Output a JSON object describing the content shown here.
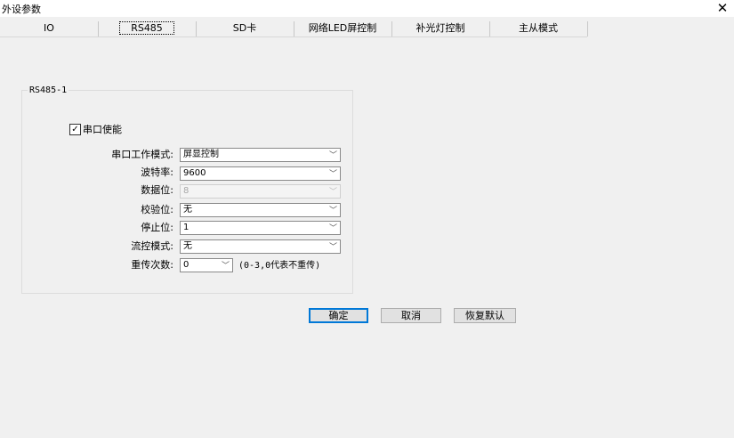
{
  "window": {
    "title": "外设参数",
    "close_glyph": "✕"
  },
  "tabs": [
    {
      "label": "IO"
    },
    {
      "label": "RS485"
    },
    {
      "label": "SD卡"
    },
    {
      "label": "网络LED屏控制"
    },
    {
      "label": "补光灯控制"
    },
    {
      "label": "主从模式"
    }
  ],
  "group": {
    "title": "RS485-1"
  },
  "serial_enable": {
    "label": "串口使能",
    "checked": true,
    "check_glyph": "✓"
  },
  "fields": {
    "work_mode": {
      "label": "串口工作模式:",
      "value": "屏显控制"
    },
    "baud_rate": {
      "label": "波特率:",
      "value": "9600"
    },
    "data_bits": {
      "label": "数据位:",
      "value": "8"
    },
    "parity": {
      "label": "校验位:",
      "value": "无"
    },
    "stop_bits": {
      "label": "停止位:",
      "value": "1"
    },
    "flow_control": {
      "label": "流控模式:",
      "value": "无"
    },
    "retry_count": {
      "label": "重传次数:",
      "value": "0",
      "hint": "(0-3,0代表不重传)"
    }
  },
  "dropdown_arrow": "﹀",
  "buttons": {
    "ok": "确定",
    "cancel": "取消",
    "restore": "恢复默认"
  }
}
